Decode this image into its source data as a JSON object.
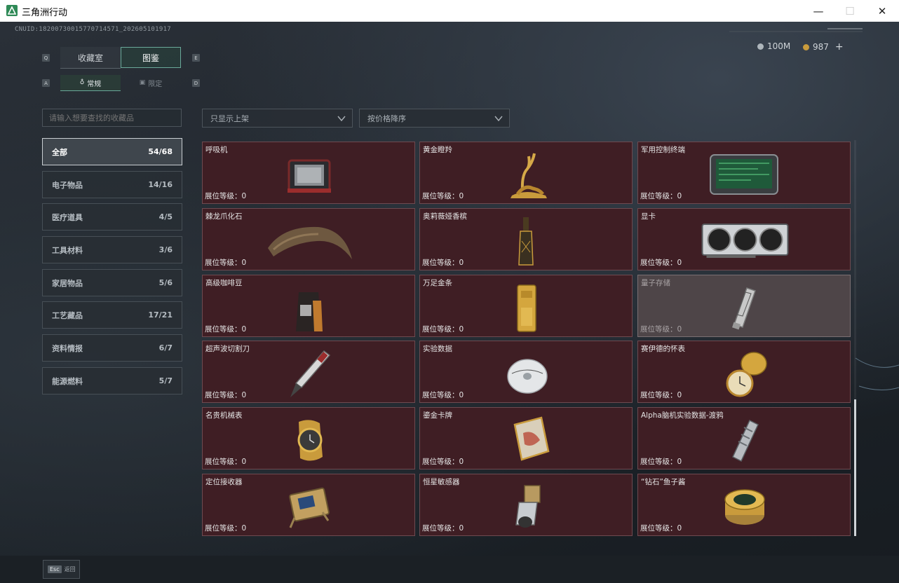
{
  "window": {
    "title": "三角洲行动",
    "controls": {
      "minimize": "—",
      "maximize": "☐",
      "close": "✕"
    }
  },
  "uid": "CNUID:18200730015770714571_202605101917",
  "tabs": {
    "key_left": "Q",
    "key_right": "E",
    "items": [
      {
        "label": "收藏室"
      },
      {
        "label": "图鉴"
      }
    ]
  },
  "subtabs": {
    "key_left": "A",
    "key_right": "D",
    "items": [
      {
        "label": "常规"
      },
      {
        "label": "限定"
      }
    ]
  },
  "currency": {
    "coins": "100M",
    "tickets": "987",
    "add": "+"
  },
  "search": {
    "placeholder": "请输入想要查找的收藏品"
  },
  "filters": {
    "display": "只显示上架",
    "sort": "按价格降序"
  },
  "categories": [
    {
      "label": "全部",
      "count": "54/68"
    },
    {
      "label": "电子物品",
      "count": "14/16"
    },
    {
      "label": "医疗道具",
      "count": "4/5"
    },
    {
      "label": "工具材料",
      "count": "3/6"
    },
    {
      "label": "家居物品",
      "count": "5/6"
    },
    {
      "label": "工艺藏品",
      "count": "17/21"
    },
    {
      "label": "资料情报",
      "count": "6/7"
    },
    {
      "label": "能源燃料",
      "count": "5/7"
    }
  ],
  "items": [
    {
      "name": "呼吸机",
      "level": "展位等级：0",
      "icon": "respirator-icon"
    },
    {
      "name": "黄金瞪羚",
      "level": "展位等级：0",
      "icon": "golden-gazelle-icon"
    },
    {
      "name": "军用控制终端",
      "level": "展位等级：0",
      "icon": "military-terminal-icon"
    },
    {
      "name": "棘龙爪化石",
      "level": "展位等级：0",
      "icon": "claw-fossil-icon"
    },
    {
      "name": "奥莉薇娅香槟",
      "level": "展位等级：0",
      "icon": "champagne-icon"
    },
    {
      "name": "显卡",
      "level": "展位等级：0",
      "icon": "graphics-card-icon"
    },
    {
      "name": "高级咖啡豆",
      "level": "展位等级：0",
      "icon": "coffee-bag-icon"
    },
    {
      "name": "万足金条",
      "level": "展位等级：0",
      "icon": "gold-bar-icon"
    },
    {
      "name": "量子存储",
      "level": "展位等级：0",
      "icon": "quantum-storage-icon"
    },
    {
      "name": "超声波切割刀",
      "level": "展位等级：0",
      "icon": "ultrasonic-knife-icon"
    },
    {
      "name": "实验数据",
      "level": "展位等级：0",
      "icon": "data-disc-icon"
    },
    {
      "name": "赛伊德的怀表",
      "level": "展位等级：0",
      "icon": "pocket-watch-icon"
    },
    {
      "name": "名贵机械表",
      "level": "展位等级：0",
      "icon": "wristwatch-icon"
    },
    {
      "name": "鎏金卡牌",
      "level": "展位等级：0",
      "icon": "gilded-card-icon"
    },
    {
      "name": "Alpha脑机实验数据-渡鸦",
      "level": "展位等级：0",
      "icon": "alpha-data-icon"
    },
    {
      "name": "定位接收器",
      "level": "展位等级：0",
      "icon": "locator-receiver-icon"
    },
    {
      "name": "恒星敏感器",
      "level": "展位等级：0",
      "icon": "star-sensor-icon"
    },
    {
      "name": "“钻石”鱼子酱",
      "level": "展位等级：0",
      "icon": "caviar-tin-icon"
    }
  ],
  "footer": {
    "esc_key": "Esc",
    "back_label": "返回"
  },
  "colors": {
    "accent": "#6aa99a",
    "card_bg": "#3f1e24",
    "card_border": "#6e4a50",
    "gold": "#c99b3c"
  }
}
